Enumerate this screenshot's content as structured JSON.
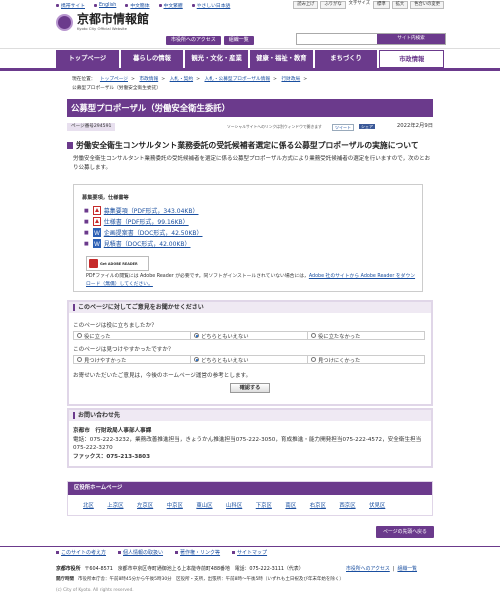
{
  "util": {
    "links": [
      "携帯サイト",
      "English",
      "中文簡体",
      "中文繁體",
      "やさしい日本語"
    ],
    "right": [
      "読み上げ",
      "ふりがな",
      "文字サイズ",
      "標準",
      "拡大",
      "色合いの変更"
    ]
  },
  "header": {
    "title": "京都市情報館",
    "subtitle": "Kyoto City Official Website",
    "access_btn": "市役所へのアクセス",
    "sitemap_btn": "組織一覧",
    "search_btn": "サイト内検索"
  },
  "nav": [
    "トップページ",
    "暮らしの情報",
    "観光・文化・産業",
    "健康・福祉・教育",
    "まちづくり",
    "市政情報"
  ],
  "crumb": {
    "label": "現在位置：",
    "items": [
      "トップページ",
      "市政情報",
      "入札・契約",
      "入札・公募型プロポーザル情報",
      "行財政局"
    ],
    "current": "公募型プロポーザル（労働安全衛生委託）"
  },
  "page": {
    "title": "公募型プロポーザル（労働安全衛生委託）",
    "page_no": "ページ番号294591",
    "meta_note": "ソーシャルサイトへのリンクは別ウィンドウで開きます",
    "tweet": "ツイート",
    "fb": "シェア",
    "date": "2022年2月9日",
    "heading": "労働安全衛生コンサルタント業務委託の受託候補者選定に係る公募型プロポーザルの実施について",
    "intro": "労働安全衛生コンサルタント業務委託の受託候補者を選定に係る公募型プロポーザル方式により業務受託候補者の選定を行いますので，次のとおり公募します。"
  },
  "docs": {
    "heading": "募集要項，仕様書等",
    "items": [
      {
        "label": "募集要項（PDF形式，343.04KB）",
        "type": "pdf"
      },
      {
        "label": "仕様書（PDF形式，99.16KB）",
        "type": "pdf"
      },
      {
        "label": "企画提案書（DOC形式，42.50KB）",
        "type": "doc"
      },
      {
        "label": "見積書（DOC形式，42.00KB）",
        "type": "doc"
      }
    ],
    "adobe_logo": "Get ADOBE READER",
    "adobe_note": "PDFファイルの閲覧には Adobe Reader が必要です。同ソフトがインストールされていない場合には，",
    "adobe_link": "Adobe 社のサイトから Adobe Reader をダウンロード（無償）してください。"
  },
  "feedback": {
    "heading": "このページに対してご意見をお聞かせください",
    "q1": "このページは役に立ちましたか？",
    "q1_opts": [
      "役に立った",
      "どちらともいえない",
      "役に立たなかった"
    ],
    "q2": "このページは見つけやすかったですか？",
    "q2_opts": [
      "見つけやすかった",
      "どちらともいえない",
      "見つけにくかった"
    ],
    "note": "お寄せいただいたご意見は，今後のホームページ運営の参考とします。",
    "submit": "確認する"
  },
  "contact": {
    "heading": "お問い合わせ先",
    "dept": "京都市　行財政局人事部人事課",
    "tel": "電話：075-222-3232，業務改善推進担当，きょうかん推進担当075-222-3050，育成推進・能力開発担当075-222-4572，安全衛生担当075-222-3270",
    "fax": "ファックス：075-213-3803"
  },
  "wards": {
    "heading": "区役所ホームページ",
    "list": [
      "北区",
      "上京区",
      "左京区",
      "中京区",
      "東山区",
      "山科区",
      "下京区",
      "南区",
      "右京区",
      "西京区",
      "伏見区"
    ]
  },
  "totop": "ページの先頭へ戻る",
  "footer": {
    "links": [
      "このサイトの考え方",
      "個人情報の取扱い",
      "著作権・リンク等",
      "サイトマップ"
    ],
    "addr_label": "京都市役所",
    "addr": "〒604-8571　京都市中京区寺町通御池上る上本能寺前町488番地　電話：075-222-3111（代表）",
    "right_links": [
      "市役所へのアクセス",
      "組織一覧"
    ],
    "hours_label": "開庁時間",
    "hours": "市役所本庁舎：午前8時45分から午後5時30分　区役所・支所，出張所：午前8時～午後5時（いずれも土日祝及び年末年始を除く）",
    "copyright": "(c) City of Kyoto. All rights reserved."
  }
}
